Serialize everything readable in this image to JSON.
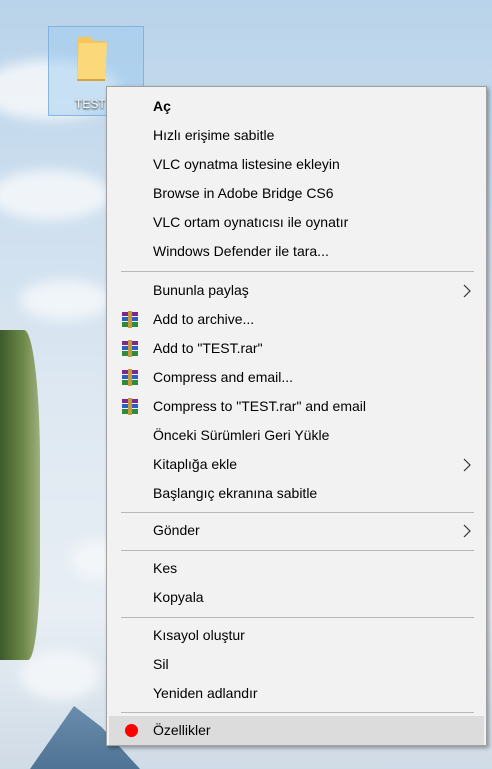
{
  "desktop": {
    "icon_label": "TEST"
  },
  "context_menu": {
    "items": [
      {
        "label": "Aç"
      },
      {
        "label": "Hızlı erişime sabitle"
      },
      {
        "label": "VLC oynatma listesine ekleyin"
      },
      {
        "label": "Browse in Adobe Bridge CS6"
      },
      {
        "label": "VLC ortam oynatıcısı ile oynatır"
      },
      {
        "label": "Windows Defender ile tara..."
      },
      {
        "label": "Bununla paylaş"
      },
      {
        "label": "Add to archive..."
      },
      {
        "label": "Add to \"TEST.rar\""
      },
      {
        "label": "Compress and email..."
      },
      {
        "label": "Compress to \"TEST.rar\" and email"
      },
      {
        "label": "Önceki Sürümleri Geri Yükle"
      },
      {
        "label": "Kitaplığa ekle"
      },
      {
        "label": "Başlangıç ekranına sabitle"
      },
      {
        "label": "Gönder"
      },
      {
        "label": "Kes"
      },
      {
        "label": "Kopyala"
      },
      {
        "label": "Kısayol oluştur"
      },
      {
        "label": "Sil"
      },
      {
        "label": "Yeniden adlandır"
      },
      {
        "label": "Özellikler"
      }
    ],
    "icons": {
      "archive": "winrar-icon",
      "submenu": "chevron-right-icon",
      "marker": "red-dot-icon"
    },
    "colors": {
      "background": "#f2f2f2",
      "hover": "#dcdcdc",
      "marker": "#ff0000"
    }
  }
}
